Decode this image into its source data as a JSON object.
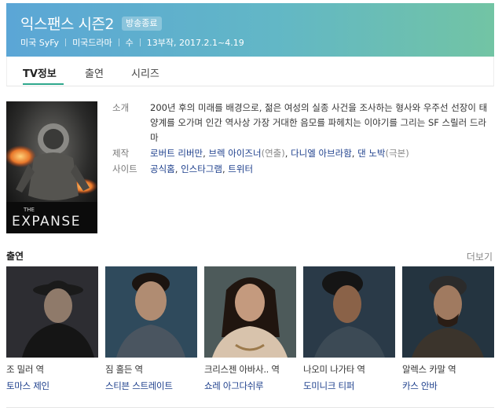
{
  "header": {
    "title": "익스팬스 시즌2",
    "badge": "방송종료",
    "meta": [
      "미국 SyFy",
      "미국드라마",
      "수",
      "13부작, 2017.2.1~4.19"
    ]
  },
  "tabs": [
    "TV정보",
    "출연",
    "시리즈"
  ],
  "poster": {
    "title_text": "THE EXPANSE"
  },
  "info": {
    "summary_label": "소개",
    "summary": "200년 후의 미래를 배경으로, 젊은 여성의 실종 사건을 조사하는 형사와 우주선 선장이 태양계를 오가며 인간 역사상 가장 거대한 음모를 파헤치는 이야기를 그리는 SF 스릴러 드라마",
    "production_label": "제작",
    "production": [
      {
        "name": "로버트 리버만",
        "role": ""
      },
      {
        "name": "브렉 아이즈너",
        "role": "연출"
      },
      {
        "name": "다니엘 아브라함",
        "role": ""
      },
      {
        "name": "댄 노박",
        "role": "극본"
      }
    ],
    "site_label": "사이트",
    "sites": [
      "공식홈",
      "인스타그램",
      "트위터"
    ]
  },
  "cast_section": {
    "title": "출연",
    "more": "더보기"
  },
  "cast": [
    {
      "role": "조 밀러 역",
      "actor": "토마스 제인"
    },
    {
      "role": "짐 홀든 역",
      "actor": "스티븐 스트레이트"
    },
    {
      "role": "크리스젠 아바사.. 역",
      "actor": "쇼레 아그다쉬루"
    },
    {
      "role": "나오미 나가타 역",
      "actor": "도미니크 티퍼"
    },
    {
      "role": "알렉스 카말 역",
      "actor": "카스 안바"
    }
  ]
}
